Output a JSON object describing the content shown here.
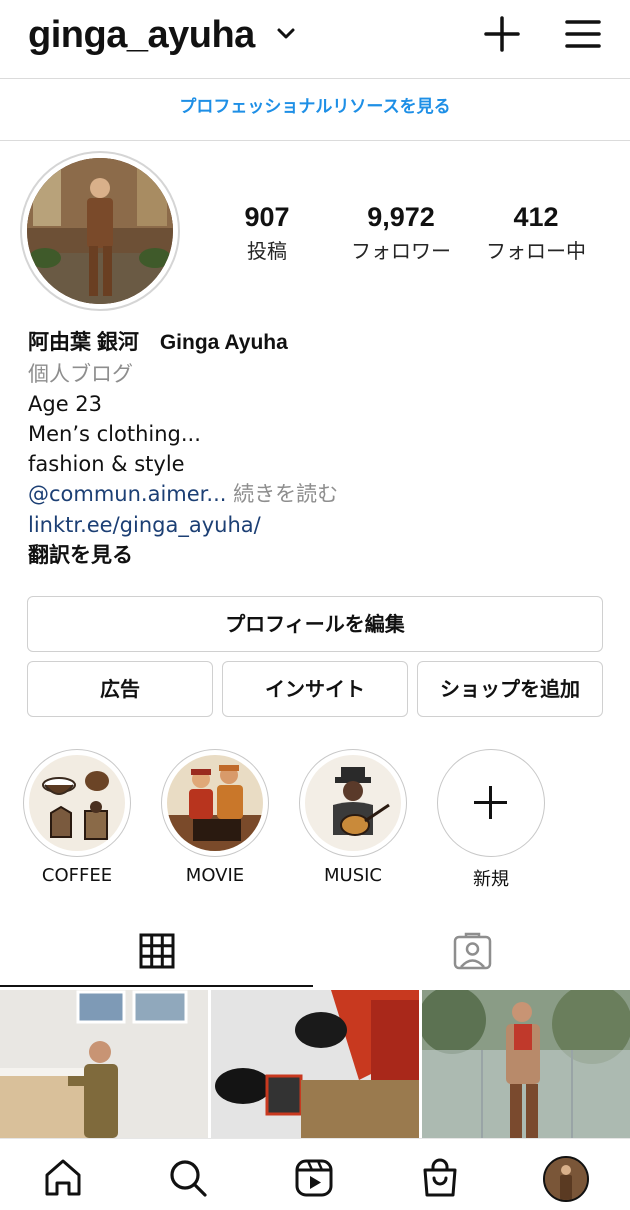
{
  "header": {
    "username": "ginga_ayuha",
    "icons": [
      "chevron-down-icon",
      "plus-icon",
      "hamburger-menu-icon"
    ]
  },
  "professional_link": "プロフェッショナルリソースを見る",
  "stats": {
    "posts": {
      "value": "907",
      "label": "投稿"
    },
    "followers": {
      "value": "9,972",
      "label": "フォロワー"
    },
    "following": {
      "value": "412",
      "label": "フォロー中"
    }
  },
  "bio": {
    "name": "阿由葉 銀河　Ginga Ayuha",
    "category": "個人ブログ",
    "lines": [
      "Age 23",
      "Men’s clothing...",
      "fashion & style"
    ],
    "mention": "@commun.aimer...",
    "more": " 続きを読む",
    "link": "linktr.ee/ginga_ayuha/",
    "translate": "翻訳を見る"
  },
  "buttons": {
    "edit_profile": "プロフィールを編集",
    "ads": "広告",
    "insights": "インサイト",
    "add_shop": "ショップを追加"
  },
  "highlights": [
    {
      "label": "COFFEE"
    },
    {
      "label": "MOVIE"
    },
    {
      "label": "MUSIC"
    },
    {
      "label": "新規"
    }
  ],
  "tabs": {
    "active": "grid",
    "icons": [
      "grid-icon",
      "tagged-person-icon"
    ]
  },
  "bottom_nav": {
    "icons": [
      "home-icon",
      "search-icon",
      "reels-icon",
      "shop-bag-icon",
      "profile-avatar"
    ]
  },
  "colors": {
    "link_blue": "#1e8fe6",
    "mention_blue": "#1c3f74",
    "secondary_gray": "#8e8e8e",
    "border": "#dbdbdb"
  }
}
